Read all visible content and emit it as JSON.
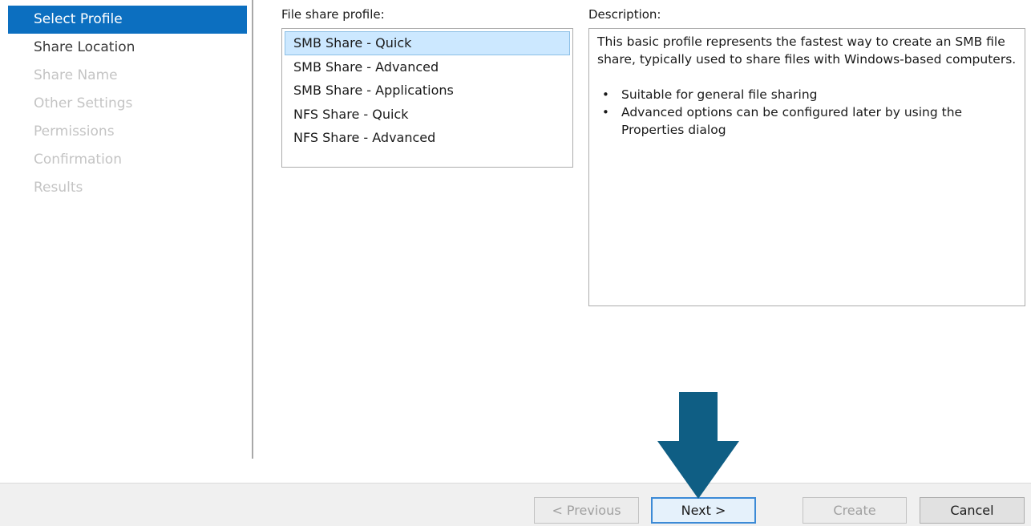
{
  "steps": [
    {
      "label": "Select Profile",
      "state": "active"
    },
    {
      "label": "Share Location",
      "state": "done"
    },
    {
      "label": "Share Name",
      "state": "disabled"
    },
    {
      "label": "Other Settings",
      "state": "disabled"
    },
    {
      "label": "Permissions",
      "state": "disabled"
    },
    {
      "label": "Confirmation",
      "state": "disabled"
    },
    {
      "label": "Results",
      "state": "disabled"
    }
  ],
  "profile": {
    "label": "File share profile:",
    "items": [
      "SMB Share - Quick",
      "SMB Share - Advanced",
      "SMB Share - Applications",
      "NFS Share - Quick",
      "NFS Share - Advanced"
    ],
    "selected": "SMB Share - Quick"
  },
  "description": {
    "label": "Description:",
    "text": "This basic profile represents the fastest way to create an SMB file share, typically used to share files with Windows-based computers.",
    "bullets": [
      "Suitable for general file sharing",
      "Advanced options can be configured later by using the Properties dialog"
    ]
  },
  "buttons": {
    "previous": "< Previous",
    "next": "Next >",
    "create": "Create",
    "cancel": "Cancel"
  },
  "annotation": {
    "icon": "down-arrow-icon",
    "color": "#0f5e84"
  },
  "colors": {
    "active_step": "#0c6fc0",
    "selected_item": "#cce8ff"
  }
}
